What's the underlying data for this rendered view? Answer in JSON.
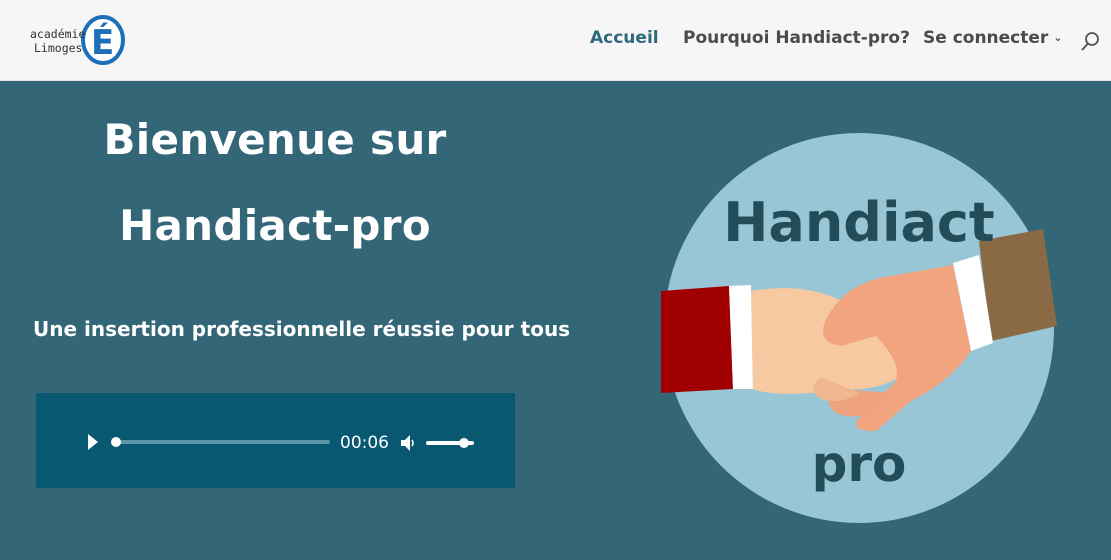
{
  "logo": {
    "line1": "académie",
    "line2": "Limoges",
    "letter": "É"
  },
  "nav": {
    "items": [
      {
        "label": "Accueil",
        "active": true
      },
      {
        "label": "Pourquoi Handiact-pro?",
        "active": false
      },
      {
        "label": "Se connecter",
        "active": false,
        "dropdown": true
      }
    ]
  },
  "hero": {
    "title_line1": "Bienvenue sur",
    "title_line2": "Handiact-pro",
    "subtitle": "Une insertion professionnelle réussie pour tous"
  },
  "player": {
    "time": "00:06",
    "progress": 0,
    "volume": 0.8
  },
  "emblem": {
    "top_text": "Handiact",
    "bottom_text": "pro"
  },
  "colors": {
    "background": "#336677",
    "header": "#f6f6f6",
    "player": "#075870",
    "nav_active": "#2e6a7d"
  }
}
